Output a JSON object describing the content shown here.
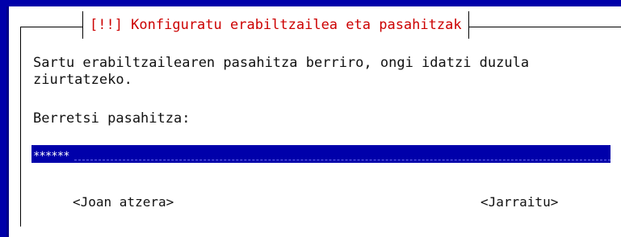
{
  "dialog": {
    "title": "[!!] Konfiguratu erabiltzailea eta pasahitzak",
    "instructions": "Sartu erabiltzailearen pasahitza berriro, ongi idatzi duzula\nziurtatzeko.",
    "field_label": "Berretsi pasahitza:",
    "password_masked": "******",
    "buttons": {
      "back": "<Joan atzera>",
      "continue": "<Jarraitu>"
    }
  }
}
